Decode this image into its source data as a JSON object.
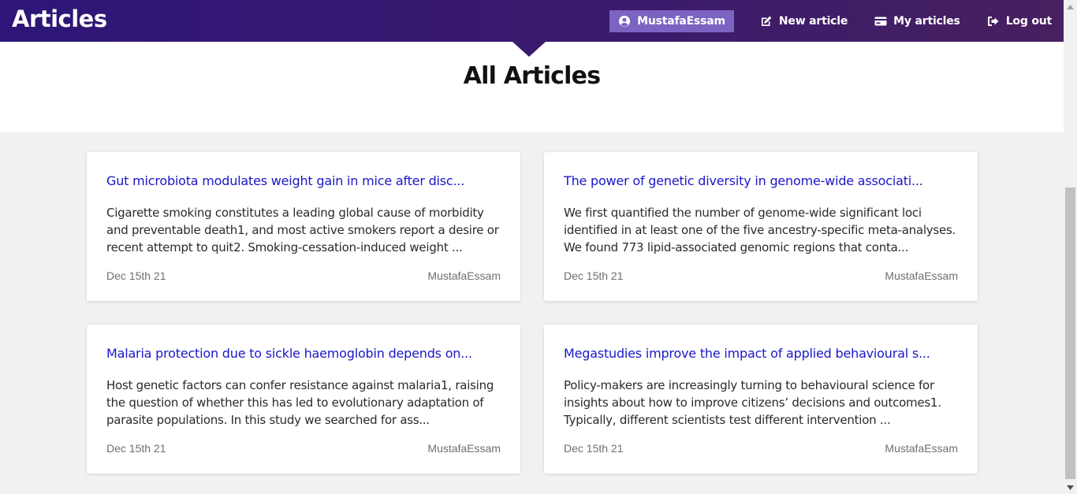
{
  "navbar": {
    "brand": "Articles",
    "user_label": "MustafaEssam",
    "new_article_label": "New article",
    "my_articles_label": "My articles",
    "logout_label": "Log out"
  },
  "page": {
    "title": "All Articles"
  },
  "articles": [
    {
      "title": "Gut microbiota modulates weight gain in mice after disc...",
      "excerpt": "Cigarette smoking constitutes a leading global cause of morbidity and preventable death1, and most active smokers report a desire or recent attempt to quit2. Smoking-cessation-induced weight ...",
      "date": "Dec 15th 21",
      "author": "MustafaEssam"
    },
    {
      "title": "The power of genetic diversity in genome-wide associati...",
      "excerpt": "We first quantified the number of genome-wide significant loci identified in at least one of the five ancestry-specific meta-analyses. We found 773 lipid-associated genomic regions that conta...",
      "date": "Dec 15th 21",
      "author": "MustafaEssam"
    },
    {
      "title": "Malaria protection due to sickle haemoglobin depends on...",
      "excerpt": "Host genetic factors can confer resistance against malaria1, raising the question of whether this has led to evolutionary adaptation of parasite populations. In this study we searched for ass...",
      "date": "Dec 15th 21",
      "author": "MustafaEssam"
    },
    {
      "title": "Megastudies improve the impact of applied behavioural s...",
      "excerpt": "Policy-makers are increasingly turning to behavioural science for insights about how to improve citizens’ decisions and outcomes1. Typically, different scientists test different intervention ...",
      "date": "Dec 15th 21",
      "author": "MustafaEssam"
    }
  ],
  "icons": {
    "user": "user-circle-icon",
    "new_article": "edit-icon",
    "my_articles": "card-icon",
    "logout": "sign-out-icon"
  },
  "colors": {
    "navbar_start": "#2d1677",
    "navbar_end": "#46205f",
    "user_badge": "#7c63c1",
    "link": "#1a17c8"
  }
}
